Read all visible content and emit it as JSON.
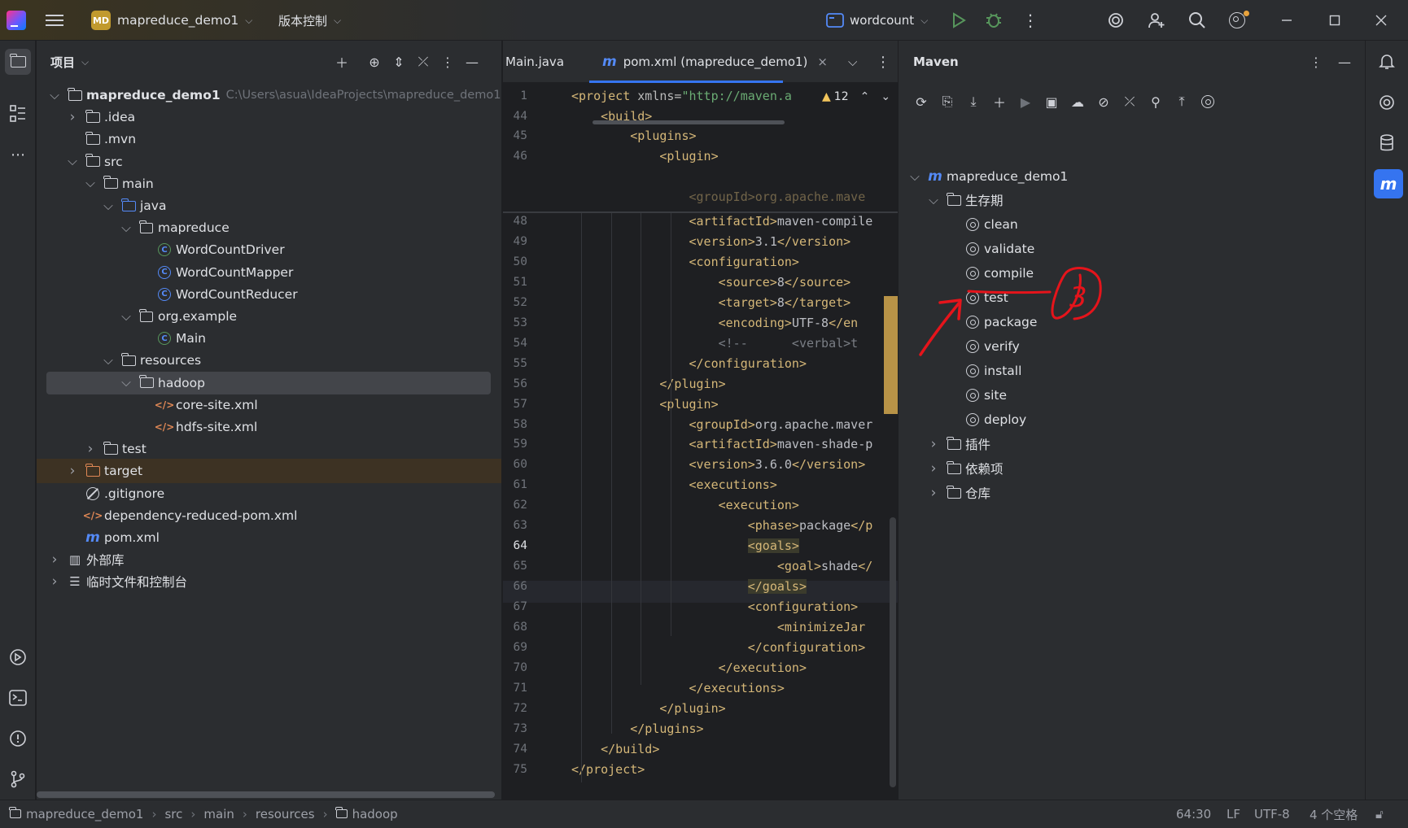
{
  "titlebar": {
    "project_badge": "MD",
    "project_name": "mapreduce_demo1",
    "vcs_label": "版本控制",
    "run_config": "wordcount"
  },
  "project_panel": {
    "title": "项目",
    "tree": [
      {
        "label": "mapreduce_demo1",
        "path": "C:\\Users\\asua\\IdeaProjects\\mapreduce_demo1",
        "icon": "module-folder",
        "expanded": true,
        "bold": true
      },
      {
        "label": ".idea",
        "icon": "folder",
        "expanded": false
      },
      {
        "label": ".mvn",
        "icon": "folder"
      },
      {
        "label": "src",
        "icon": "folder",
        "expanded": true
      },
      {
        "label": "main",
        "icon": "folder",
        "expanded": true
      },
      {
        "label": "java",
        "icon": "source-folder",
        "expanded": true
      },
      {
        "label": "mapreduce",
        "icon": "package",
        "expanded": true
      },
      {
        "label": "WordCountDriver",
        "icon": "class-run"
      },
      {
        "label": "WordCountMapper",
        "icon": "class"
      },
      {
        "label": "WordCountReducer",
        "icon": "class"
      },
      {
        "label": "org.example",
        "icon": "package",
        "expanded": true
      },
      {
        "label": "Main",
        "icon": "class-run"
      },
      {
        "label": "resources",
        "icon": "resources-folder",
        "expanded": true
      },
      {
        "label": "hadoop",
        "icon": "folder",
        "expanded": true,
        "selected": true
      },
      {
        "label": "core-site.xml",
        "icon": "xml"
      },
      {
        "label": "hdfs-site.xml",
        "icon": "xml"
      },
      {
        "label": "test",
        "icon": "folder",
        "expanded": false
      },
      {
        "label": "target",
        "icon": "excluded-folder",
        "expanded": false
      },
      {
        "label": ".gitignore",
        "icon": "ignored"
      },
      {
        "label": "dependency-reduced-pom.xml",
        "icon": "xml"
      },
      {
        "label": "pom.xml",
        "icon": "maven"
      },
      {
        "label": "外部库",
        "icon": "library",
        "expanded": false
      },
      {
        "label": "临时文件和控制台",
        "icon": "scratches",
        "expanded": false
      }
    ]
  },
  "editor": {
    "tabs": [
      {
        "label": "Main.java",
        "active": false
      },
      {
        "label": "pom.xml (mapreduce_demo1)",
        "active": true
      }
    ],
    "warning_count": "12",
    "lines": [
      {
        "n": "1",
        "text": "<project xmlns=\"http://maven.a"
      },
      {
        "n": "44",
        "text": "    <build>"
      },
      {
        "n": "45",
        "text": "        <plugins>"
      },
      {
        "n": "46",
        "text": "            <plugin>"
      },
      {
        "n": "48",
        "text": "                <artifactId>maven-compile"
      },
      {
        "n": "49",
        "text": "                <version>3.1</version>"
      },
      {
        "n": "50",
        "text": "                <configuration>"
      },
      {
        "n": "51",
        "text": "                    <source>8</source>"
      },
      {
        "n": "52",
        "text": "                    <target>8</target>"
      },
      {
        "n": "53",
        "text": "                    <encoding>UTF-8</en"
      },
      {
        "n": "54",
        "text": "                    <!--      <verbal>t"
      },
      {
        "n": "55",
        "text": "                </configuration>"
      },
      {
        "n": "56",
        "text": "            </plugin>"
      },
      {
        "n": "57",
        "text": "            <plugin>"
      },
      {
        "n": "58",
        "text": "                <groupId>org.apache.maver"
      },
      {
        "n": "59",
        "text": "                <artifactId>maven-shade-p"
      },
      {
        "n": "60",
        "text": "                <version>3.6.0</version>"
      },
      {
        "n": "61",
        "text": "                <executions>"
      },
      {
        "n": "62",
        "text": "                    <execution>"
      },
      {
        "n": "63",
        "text": "                        <phase>package</p"
      },
      {
        "n": "64",
        "text": "                        <goals>"
      },
      {
        "n": "65",
        "text": "                            <goal>shade</"
      },
      {
        "n": "66",
        "text": "                        </goals>"
      },
      {
        "n": "67",
        "text": "                        <configuration>"
      },
      {
        "n": "68",
        "text": "                            <minimizeJar"
      },
      {
        "n": "69",
        "text": "                        </configuration>"
      },
      {
        "n": "70",
        "text": "                    </execution>"
      },
      {
        "n": "71",
        "text": "                </executions>"
      },
      {
        "n": "72",
        "text": "            </plugin>"
      },
      {
        "n": "73",
        "text": "        </plugins>"
      },
      {
        "n": "74",
        "text": "    </build>"
      },
      {
        "n": "75",
        "text": "</project>"
      }
    ]
  },
  "maven": {
    "title": "Maven",
    "root": "mapreduce_demo1",
    "lifecycle_label": "生存期",
    "lifecycle": [
      "clean",
      "validate",
      "compile",
      "test",
      "package",
      "verify",
      "install",
      "site",
      "deploy"
    ],
    "plugins_label": "插件",
    "deps_label": "依赖项",
    "repos_label": "仓库"
  },
  "annotation": {
    "mark": "3",
    "color": "#e5141b"
  },
  "statusbar": {
    "breadcrumbs": [
      "mapreduce_demo1",
      "src",
      "main",
      "resources",
      "hadoop"
    ],
    "position": "64:30",
    "line_sep": "LF",
    "encoding": "UTF-8",
    "indent": "4 个空格"
  },
  "colors": {
    "accent": "#3574f0",
    "tag": "#d5b778",
    "string": "#6aab73",
    "bg": "#1e1f22",
    "panel": "#2b2d30"
  }
}
